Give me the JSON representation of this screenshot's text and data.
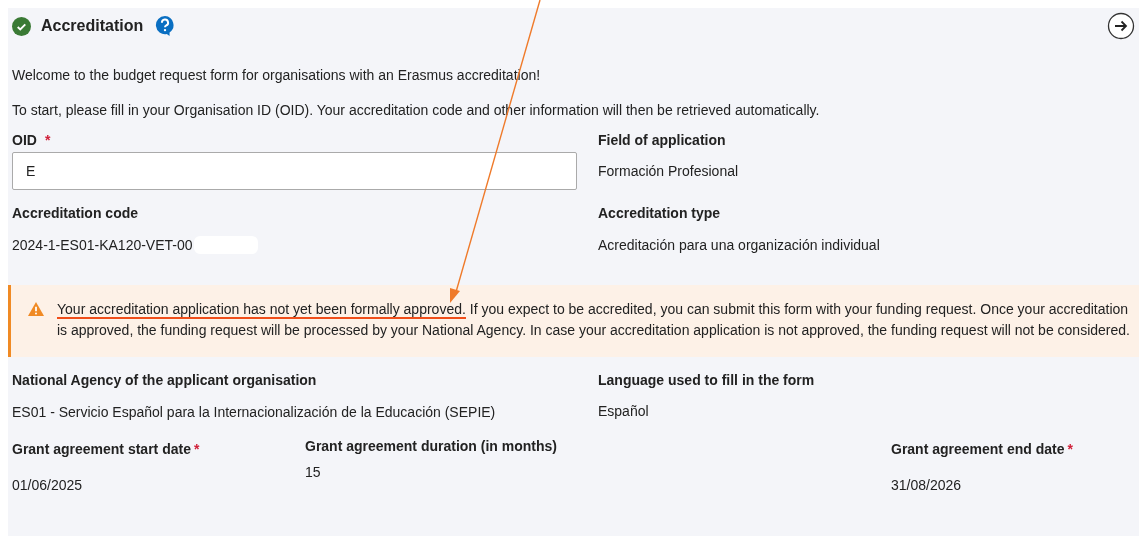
{
  "section": {
    "title": "Accreditation",
    "completed": true
  },
  "intro": [
    "Welcome to the budget request form for organisations with an Erasmus accreditation!",
    "To start, please fill in your Organisation ID (OID). Your accreditation code and other information will then be retrieved automatically."
  ],
  "fields_top": [
    {
      "label": "OID",
      "required_mark": "*",
      "kind": "input",
      "value": "E"
    },
    {
      "label": "Field of application",
      "kind": "text",
      "value": "Formación Profesional"
    },
    {
      "label": "Accreditation code",
      "kind": "redacted",
      "value": "2024-1-ES01-KA120-VET-00"
    },
    {
      "label": "Accreditation type",
      "kind": "text",
      "value": "Acreditación para una organización individual"
    }
  ],
  "warning": {
    "highlighted": "Your accreditation application has not yet been formally approved.",
    "text": "If you expect to be accredited, you can submit this form with your funding request. Once your accreditation is approved, the funding request will be processed by your National Agency. In case your accreditation application is not approved, the funding request will not be considered."
  },
  "fields_mid": [
    {
      "label": "National Agency of the applicant organisation",
      "value": "ES01 - Servicio Español para la Internacionalización de la Educación (SEPIE)"
    },
    {
      "label": "Language used to fill in the form",
      "value": "Español"
    }
  ],
  "fields_dates": [
    {
      "label": "Grant agreement start date",
      "required_mark": "*",
      "value": "01/06/2025"
    },
    {
      "label": "Grant agreement duration (in months)",
      "value": "15"
    },
    {
      "label": "Grant agreement end date",
      "required_mark": "*",
      "value": "31/08/2026"
    }
  ]
}
